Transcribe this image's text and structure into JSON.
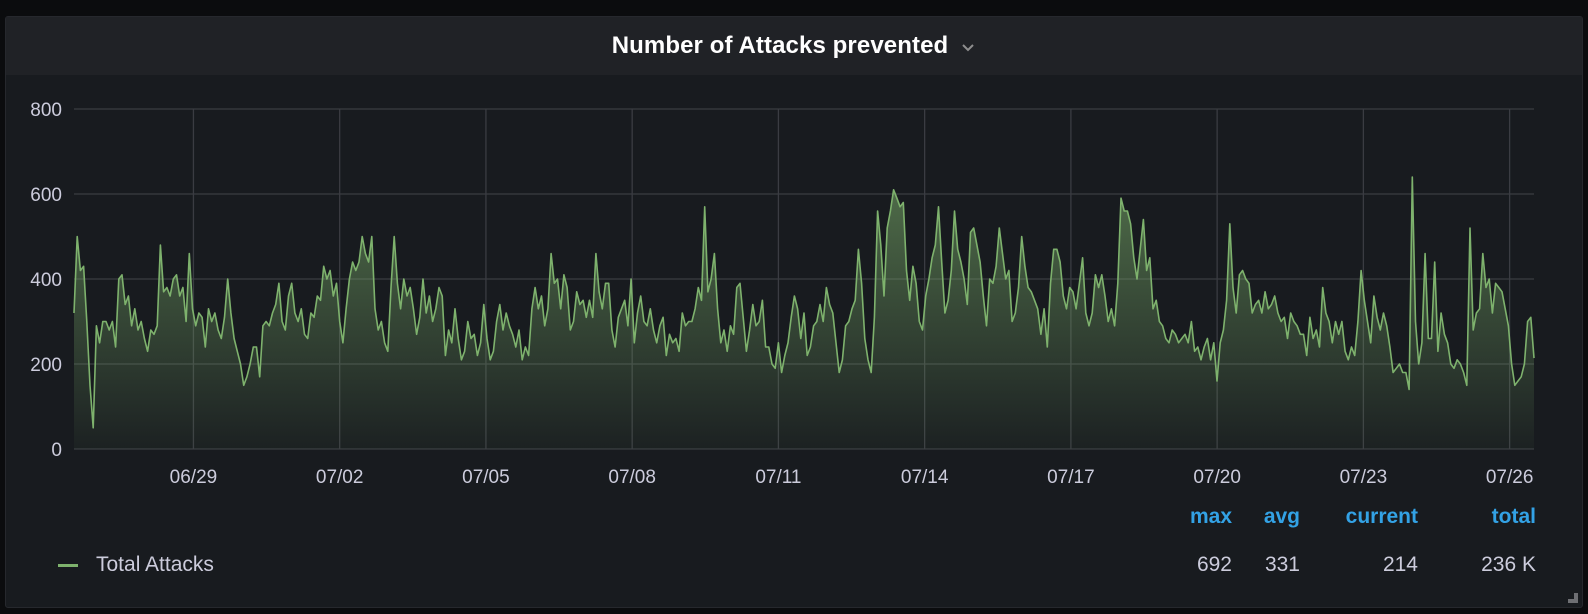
{
  "panel": {
    "title": "Number of Attacks prevented",
    "menu_icon": "chevron-down-icon"
  },
  "legend": {
    "series_label": "Total Attacks",
    "series_color": "#7eb26d",
    "columns": [
      {
        "key": "max",
        "label": "max",
        "value": "692"
      },
      {
        "key": "avg",
        "label": "avg",
        "value": "331"
      },
      {
        "key": "current",
        "label": "current",
        "value": "214"
      },
      {
        "key": "total",
        "label": "total",
        "value": "236 K"
      }
    ]
  },
  "colors": {
    "line": "#7eb26d",
    "legend_header": "#33a2e5",
    "grid": "#3a3c42",
    "text": "#ccccdc"
  },
  "chart_data": {
    "type": "area",
    "title": "Number of Attacks prevented",
    "xlabel": "",
    "ylabel": "",
    "ylim": [
      0,
      800
    ],
    "yticks": [
      0,
      200,
      400,
      600,
      800
    ],
    "grid": true,
    "legend_placement": "bottom",
    "x_start_day": -2.45,
    "x_end_day": 27.5,
    "x_tick_days": [
      0,
      3,
      6,
      9,
      12,
      15,
      18,
      21,
      24,
      27
    ],
    "x_tick_labels": [
      "06/29",
      "07/02",
      "07/05",
      "07/08",
      "07/11",
      "07/14",
      "07/17",
      "07/20",
      "07/23",
      "07/26"
    ],
    "series": [
      {
        "name": "Total Attacks",
        "step_hours": 3,
        "values": [
          320,
          500,
          420,
          430,
          300,
          150,
          50,
          290,
          250,
          300,
          300,
          280,
          300,
          240,
          400,
          410,
          340,
          360,
          290,
          330,
          280,
          300,
          260,
          230,
          280,
          270,
          290,
          480,
          370,
          380,
          360,
          400,
          410,
          360,
          380,
          300,
          460,
          330,
          290,
          320,
          310,
          240,
          330,
          300,
          320,
          280,
          260,
          310,
          400,
          320,
          260,
          230,
          200,
          150,
          170,
          200,
          240,
          240,
          170,
          290,
          300,
          290,
          320,
          340,
          390,
          300,
          280,
          360,
          390,
          320,
          300,
          330,
          270,
          260,
          320,
          310,
          360,
          350,
          430,
          400,
          420,
          360,
          390,
          300,
          250,
          330,
          400,
          440,
          420,
          440,
          500,
          460,
          440,
          500,
          330,
          280,
          300,
          250,
          230,
          380,
          500,
          390,
          330,
          400,
          360,
          380,
          330,
          270,
          310,
          400,
          320,
          360,
          300,
          330,
          380,
          360,
          220,
          280,
          250,
          330,
          260,
          210,
          230,
          300,
          260,
          270,
          220,
          250,
          340,
          260,
          210,
          230,
          300,
          340,
          280,
          320,
          290,
          270,
          240,
          280,
          210,
          240,
          220,
          330,
          380,
          330,
          360,
          290,
          330,
          460,
          390,
          400,
          330,
          410,
          380,
          280,
          300,
          370,
          340,
          350,
          310,
          350,
          310,
          460,
          370,
          330,
          390,
          390,
          280,
          240,
          310,
          330,
          350,
          290,
          400,
          250,
          320,
          360,
          300,
          290,
          330,
          280,
          250,
          290,
          310,
          220,
          270,
          250,
          260,
          230,
          320,
          290,
          300,
          300,
          330,
          380,
          350,
          570,
          370,
          400,
          460,
          330,
          250,
          280,
          230,
          290,
          270,
          380,
          390,
          310,
          230,
          280,
          340,
          290,
          300,
          350,
          240,
          240,
          200,
          190,
          250,
          180,
          220,
          250,
          310,
          360,
          330,
          260,
          320,
          220,
          240,
          290,
          300,
          340,
          300,
          380,
          340,
          320,
          250,
          180,
          210,
          290,
          300,
          330,
          350,
          470,
          390,
          260,
          210,
          180,
          310,
          560,
          480,
          360,
          520,
          560,
          610,
          590,
          570,
          580,
          420,
          350,
          430,
          390,
          300,
          280,
          360,
          400,
          450,
          480,
          570,
          440,
          320,
          350,
          420,
          560,
          470,
          440,
          400,
          340,
          510,
          520,
          480,
          440,
          360,
          290,
          400,
          390,
          430,
          520,
          460,
          400,
          420,
          300,
          320,
          380,
          500,
          430,
          380,
          370,
          350,
          330,
          270,
          330,
          240,
          390,
          470,
          470,
          440,
          360,
          330,
          380,
          370,
          330,
          390,
          450,
          320,
          290,
          320,
          410,
          380,
          410,
          360,
          300,
          330,
          290,
          390,
          590,
          560,
          560,
          530,
          450,
          400,
          470,
          540,
          420,
          450,
          330,
          350,
          300,
          290,
          260,
          250,
          280,
          270,
          250,
          260,
          270,
          250,
          300,
          230,
          240,
          210,
          240,
          260,
          210,
          250,
          160,
          250,
          280,
          350,
          530,
          380,
          320,
          410,
          420,
          400,
          390,
          320,
          340,
          350,
          320,
          370,
          330,
          340,
          360,
          320,
          300,
          310,
          260,
          320,
          300,
          290,
          270,
          270,
          220,
          310,
          260,
          280,
          240,
          380,
          320,
          300,
          250,
          300,
          270,
          300,
          230,
          210,
          240,
          220,
          300,
          420,
          350,
          300,
          250,
          360,
          310,
          280,
          320,
          290,
          240,
          180,
          190,
          200,
          180,
          180,
          140,
          640,
          300,
          200,
          250,
          460,
          260,
          260,
          440,
          230,
          320,
          270,
          250,
          200,
          190,
          210,
          200,
          180,
          150,
          520,
          280,
          320,
          330,
          460,
          380,
          400,
          320,
          390,
          380,
          370,
          330,
          290,
          200,
          150,
          160,
          170,
          200,
          300,
          310,
          214
        ]
      }
    ]
  }
}
